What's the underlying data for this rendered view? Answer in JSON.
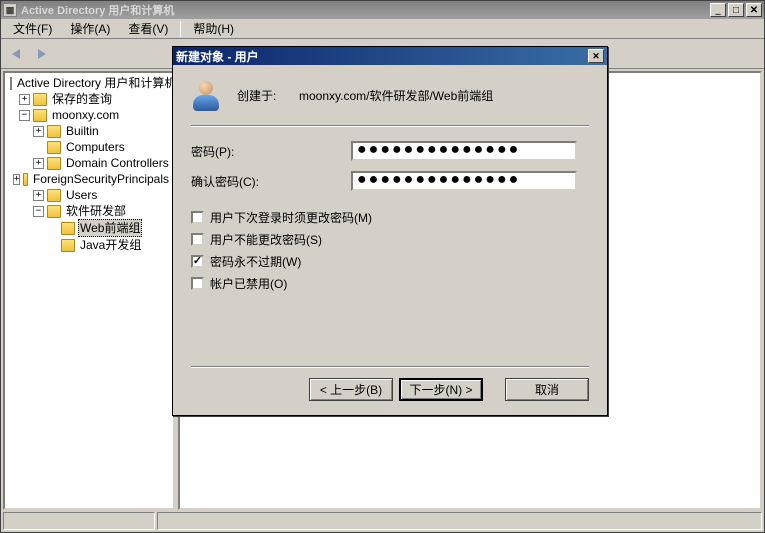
{
  "app": {
    "title": "Active Directory 用户和计算机",
    "window_buttons": {
      "min": "_",
      "max": "□",
      "close": "✕"
    }
  },
  "menu": {
    "file": "文件(F)",
    "action": "操作(A)",
    "view": "查看(V)",
    "help": "帮助(H)"
  },
  "tree": {
    "root": "Active Directory 用户和计算机",
    "saved_queries": "保存的查询",
    "domain": "moonxy.com",
    "builtin": "Builtin",
    "computers": "Computers",
    "domain_controllers": "Domain Controllers",
    "fsp": "ForeignSecurityPrincipals",
    "users": "Users",
    "dev_dept": "软件研发部",
    "web_group": "Web前端组",
    "java_group": "Java开发组"
  },
  "dialog": {
    "title": "新建对象 - 用户",
    "create_in_label": "创建于:",
    "create_in_path": "moonxy.com/软件研发部/Web前端组",
    "password_label": "密码(P):",
    "password_value": "●●●●●●●●●●●●●●",
    "confirm_label": "确认密码(C):",
    "confirm_value": "●●●●●●●●●●●●●●",
    "chk_must_change": "用户下次登录时须更改密码(M)",
    "chk_cannot_change": "用户不能更改密码(S)",
    "chk_never_expires": "密码永不过期(W)",
    "chk_disabled": "帐户已禁用(O)",
    "checked": {
      "must_change": false,
      "cannot_change": false,
      "never_expires": true,
      "disabled": false
    },
    "btn_back": "< 上一步(B)",
    "btn_next": "下一步(N) >",
    "btn_cancel": "取消",
    "close": "✕"
  }
}
